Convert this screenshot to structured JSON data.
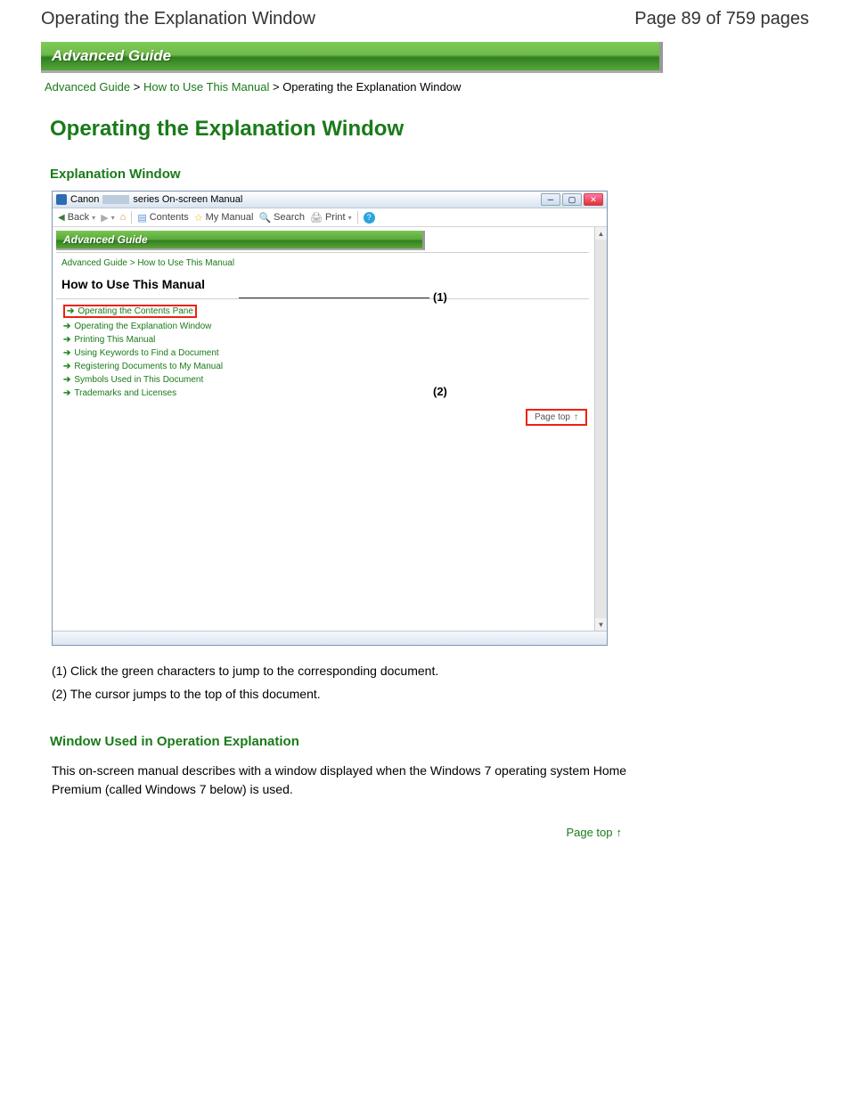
{
  "header": {
    "title": "Operating the Explanation Window",
    "page_indicator": "Page 89 of 759 pages"
  },
  "banner": "Advanced Guide",
  "breadcrumb": {
    "link1": "Advanced Guide",
    "sep": " > ",
    "link2": "How to Use This Manual",
    "current": "Operating the Explanation Window"
  },
  "h1": "Operating the Explanation Window",
  "section1_title": "Explanation Window",
  "screenshot": {
    "titlebar": {
      "brand": "Canon",
      "rest": "series On-screen Manual"
    },
    "toolbar": {
      "back": "Back",
      "contents": "Contents",
      "mymanual": "My Manual",
      "search": "Search",
      "print": "Print"
    },
    "inner_banner": "Advanced Guide",
    "inner_crumb": "Advanced Guide > How to Use This Manual",
    "inner_h2": "How to Use This Manual",
    "links": [
      "Operating the Contents Pane",
      "Operating the Explanation Window",
      "Printing This Manual",
      "Using Keywords to Find a Document",
      "Registering Documents to My Manual",
      "Symbols Used in This Document",
      "Trademarks and Licenses"
    ],
    "pagetop": "Page top",
    "callout1": "(1)",
    "callout2": "(2)"
  },
  "notes": {
    "n1": "(1) Click the green characters to jump to the corresponding document.",
    "n2": "(2) The cursor jumps to the top of this document."
  },
  "section2_title": "Window Used in Operation Explanation",
  "section2_body": "This on-screen manual describes with a window displayed when the Windows 7 operating system Home Premium (called Windows 7 below) is used.",
  "pagetop_link": "Page top"
}
